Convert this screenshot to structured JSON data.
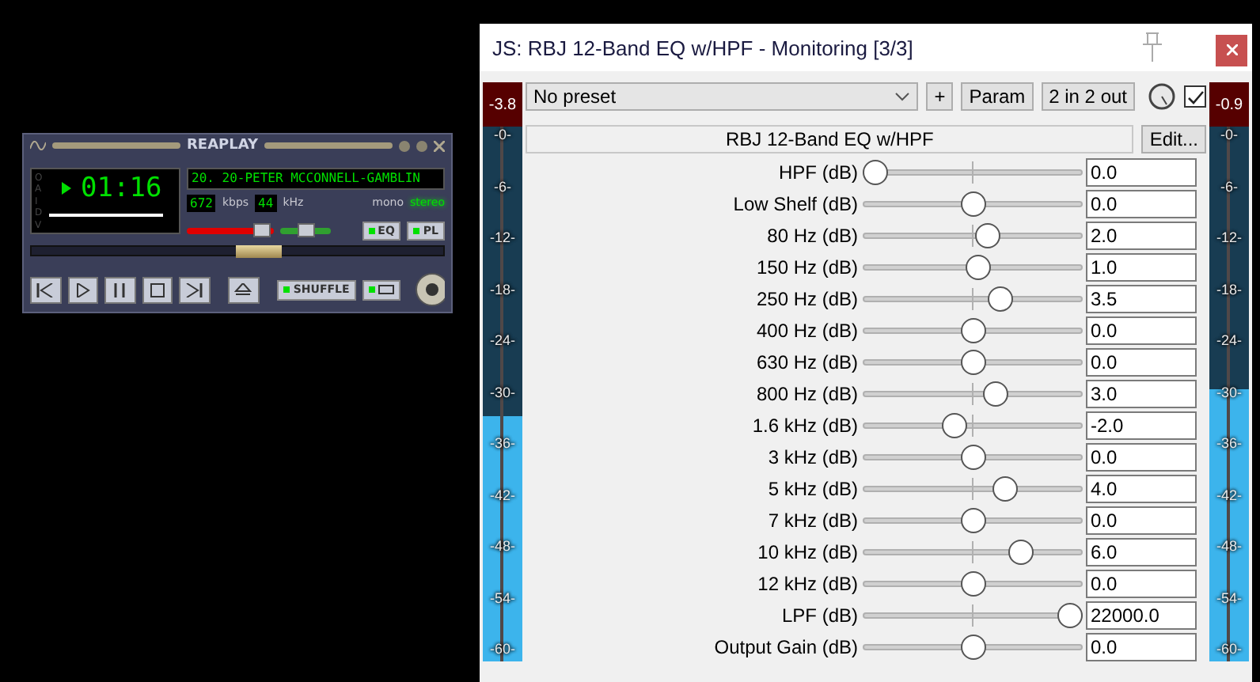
{
  "player": {
    "title": "REAPLAY",
    "clutter": [
      "O",
      "A",
      "I",
      "D",
      "V"
    ],
    "playing": true,
    "time": "01:16",
    "track": "20. 20-PETER MCCONNELL-GAMBLIN",
    "bitrate": "672",
    "bitrate_unit": "kbps",
    "samplerate": "44",
    "samplerate_unit": "kHz",
    "channels": [
      {
        "label": "mono",
        "selected": false
      },
      {
        "label": "stereo",
        "selected": true
      }
    ],
    "volume": {
      "level": 0.95
    },
    "balance": {
      "level": 0.5
    },
    "toggles": [
      {
        "label": "EQ",
        "on": true
      },
      {
        "label": "PL",
        "on": true
      }
    ],
    "seek": {
      "level": 0.55
    },
    "shuffle": {
      "label": "SHUFFLE",
      "on": true
    },
    "repeat": {
      "on": true
    }
  },
  "window": {
    "title": "JS: RBJ 12-Band EQ w/HPF - Monitoring [3/3]",
    "preset": "No preset",
    "buttons": [
      "+",
      "Param",
      "2 in 2 out"
    ],
    "enabled": true,
    "plugin_name": "RBJ 12-Band EQ w/HPF",
    "edit_button": "Edit...",
    "meters": [
      {
        "peak": "-3.8",
        "level": 0.46,
        "scale": [
          "-0-",
          "-6-",
          "-12-",
          "-18-",
          "-24-",
          "-30-",
          "-36-",
          "-42-",
          "-48-",
          "-54-",
          "-60-"
        ]
      },
      {
        "peak": "-0.9",
        "level": 0.51,
        "scale": [
          "-0-",
          "-6-",
          "-12-",
          "-18-",
          "-24-",
          "-30-",
          "-36-",
          "-42-",
          "-48-",
          "-54-",
          "-60-"
        ]
      }
    ],
    "params": [
      {
        "label": "HPF (dB)",
        "level": 0,
        "value": "0.0"
      },
      {
        "label": "Low Shelf (dB)",
        "level": 0.5,
        "value": "0.0"
      },
      {
        "label": "80 Hz (dB)",
        "level": 0.58,
        "value": "2.0"
      },
      {
        "label": "150 Hz (dB)",
        "level": 0.53,
        "value": "1.0"
      },
      {
        "label": "250 Hz (dB)",
        "level": 0.64,
        "value": "3.5"
      },
      {
        "label": "400 Hz (dB)",
        "level": 0.5,
        "value": "0.0"
      },
      {
        "label": "630 Hz (dB)",
        "level": 0.5,
        "value": "0.0"
      },
      {
        "label": "800 Hz (dB)",
        "level": 0.62,
        "value": "3.0"
      },
      {
        "label": "1.6 kHz (dB)",
        "level": 0.41,
        "value": "-2.0"
      },
      {
        "label": "3 kHz (dB)",
        "level": 0.5,
        "value": "0.0"
      },
      {
        "label": "5 kHz (dB)",
        "level": 0.67,
        "value": "4.0"
      },
      {
        "label": "7 kHz (dB)",
        "level": 0.5,
        "value": "0.0"
      },
      {
        "label": "10 kHz (dB)",
        "level": 0.75,
        "value": "6.0"
      },
      {
        "label": "12 kHz (dB)",
        "level": 0.5,
        "value": "0.0"
      },
      {
        "label": "LPF (dB)",
        "level": 1,
        "value": "22000.0"
      },
      {
        "label": "Output Gain (dB)",
        "level": 0.5,
        "value": "0.0"
      }
    ]
  }
}
